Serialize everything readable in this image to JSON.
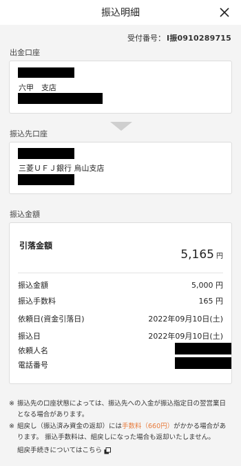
{
  "header": {
    "title": "振込明細"
  },
  "receipt": {
    "label": "受付番号：",
    "number": "I振0910289715"
  },
  "source_account": {
    "section_label": "出金口座",
    "branch": "六甲　支店"
  },
  "dest_account": {
    "section_label": "振込先口座",
    "bank_branch": "三菱ＵＦＪ銀行 烏山支店"
  },
  "transfer": {
    "section_label": "振込金額",
    "debit_label": "引落金額",
    "debit_amount": "5,165",
    "yen": "円",
    "rows": [
      {
        "label": "振込金額",
        "value": "5,000 円"
      },
      {
        "label": "振込手数料",
        "value": "165 円"
      },
      {
        "label": "依頼日(資金引落日)",
        "value": "2022年09月10日(土)"
      },
      {
        "label": "振込日",
        "value": "2022年09月10日(土)"
      },
      {
        "label": "依頼人名",
        "value": ""
      },
      {
        "label": "電話番号",
        "value": ""
      }
    ]
  },
  "notes": {
    "mark": "※",
    "note1": "振込先の口座状態によっては、振込先への入金が振込指定日の翌営業日となる場合があります。",
    "note2_a": "組戻し（振込済み資金の返却）には",
    "note2_fee": "手数料（660円）",
    "note2_b": "がかかる場合があります。 振込手数料は、組戻しになった場合も返却いたしません。",
    "link_label": "組戻手続きについてはこちら"
  }
}
